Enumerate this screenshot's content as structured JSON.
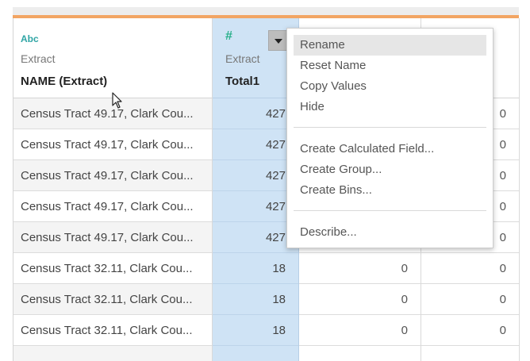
{
  "columns": [
    {
      "type_icon": "Abc",
      "source": "Extract",
      "name": "NAME (Extract)"
    },
    {
      "type_icon": "#",
      "source": "Extract",
      "name": "Total1"
    }
  ],
  "rows": [
    {
      "name": "Census Tract 49.17, Clark Cou...",
      "total": "427",
      "c3": "",
      "c4": "0"
    },
    {
      "name": "Census Tract 49.17, Clark Cou...",
      "total": "427",
      "c3": "",
      "c4": "0"
    },
    {
      "name": "Census Tract 49.17, Clark Cou...",
      "total": "427",
      "c3": "",
      "c4": "0"
    },
    {
      "name": "Census Tract 49.17, Clark Cou...",
      "total": "427",
      "c3": "",
      "c4": "0"
    },
    {
      "name": "Census Tract 49.17, Clark Cou...",
      "total": "427",
      "c3": "",
      "c4": "0"
    },
    {
      "name": "Census Tract 32.11, Clark Cou...",
      "total": "18",
      "c3": "0",
      "c4": "0"
    },
    {
      "name": "Census Tract 32.11, Clark Cou...",
      "total": "18",
      "c3": "0",
      "c4": "0"
    },
    {
      "name": "Census Tract 32.11, Clark Cou...",
      "total": "18",
      "c3": "0",
      "c4": "0"
    }
  ],
  "context_menu": {
    "items": [
      "Rename",
      "Reset Name",
      "Copy Values",
      "Hide",
      "Create Calculated Field...",
      "Create Group...",
      "Create Bins...",
      "Describe..."
    ],
    "highlighted": "Rename"
  },
  "icons": {
    "dropdown": "chevron-down-icon",
    "cursor": "mouse-pointer-icon",
    "string_type": "abc-type-icon",
    "number_type": "number-type-icon"
  },
  "colors": {
    "accent_band": "#f2a563",
    "selected_column": "#cfe3f5",
    "number_icon": "#28b08a",
    "string_icon": "#2fa5a5"
  }
}
